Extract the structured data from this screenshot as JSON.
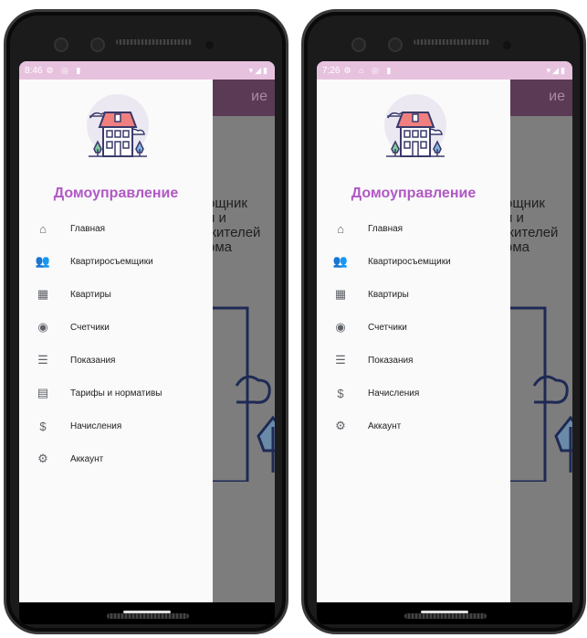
{
  "phones": [
    {
      "status_time": "8:46",
      "appbar_title_fragment": "ие",
      "bg_text": "ощник\nи и жителей\nома",
      "drawer_title": "Домоуправление",
      "menu": [
        {
          "icon": "home-icon",
          "label": "Главная"
        },
        {
          "icon": "people-icon",
          "label": "Квартиросъемщики"
        },
        {
          "icon": "building-icon",
          "label": "Квартиры"
        },
        {
          "icon": "meter-icon",
          "label": "Счетчики"
        },
        {
          "icon": "list-icon",
          "label": "Показания"
        },
        {
          "icon": "calculator-icon",
          "label": "Тарифы и нормативы"
        },
        {
          "icon": "dollar-icon",
          "label": "Начисления"
        },
        {
          "icon": "account-settings-icon",
          "label": "Аккаунт"
        }
      ]
    },
    {
      "status_time": "7:26",
      "appbar_title_fragment": "ие",
      "bg_text": "ощник\nи и жителей\nома",
      "drawer_title": "Домоуправление",
      "menu": [
        {
          "icon": "home-icon",
          "label": "Главная"
        },
        {
          "icon": "people-icon",
          "label": "Квартиросъемщики"
        },
        {
          "icon": "building-icon",
          "label": "Квартиры"
        },
        {
          "icon": "meter-icon",
          "label": "Счетчики"
        },
        {
          "icon": "list-icon",
          "label": "Показания"
        },
        {
          "icon": "dollar-icon",
          "label": "Начисления"
        },
        {
          "icon": "account-settings-icon",
          "label": "Аккаунт"
        }
      ]
    }
  ],
  "colors": {
    "accent": "#b058c4",
    "statusbar": "#e7c2df",
    "appbar": "#5b3a55"
  }
}
